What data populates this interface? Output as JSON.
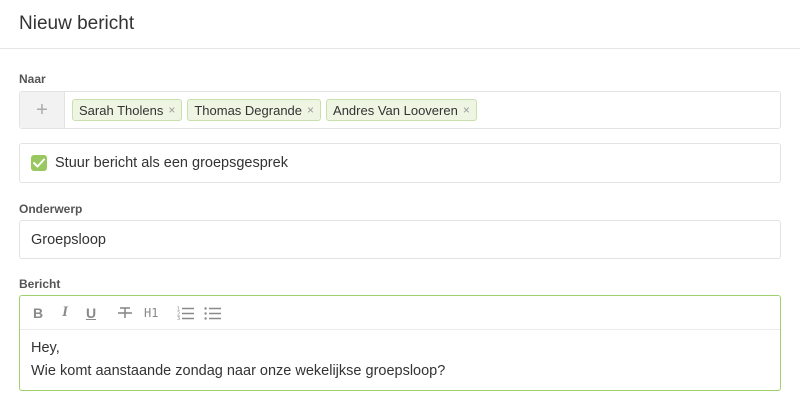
{
  "header": {
    "title": "Nieuw bericht"
  },
  "recipients": {
    "label": "Naar",
    "add_symbol": "+",
    "items": [
      {
        "name": "Sarah Tholens",
        "remove": "×"
      },
      {
        "name": "Thomas Degrande",
        "remove": "×"
      },
      {
        "name": "Andres Van Looveren",
        "remove": "×"
      }
    ]
  },
  "group_option": {
    "label": "Stuur bericht als een groepsgesprek",
    "checked": true
  },
  "subject": {
    "label": "Onderwerp",
    "value": "Groepsloop"
  },
  "message": {
    "label": "Bericht",
    "toolbar": {
      "bold": "B",
      "italic": "I",
      "underline": "U",
      "heading": "H1"
    },
    "lines": [
      "Hey,",
      "Wie komt aanstaande zondag naar onze wekelijkse groepsloop?"
    ]
  },
  "colors": {
    "accent": "#99c760",
    "chip_bg": "#eef5e3",
    "chip_border": "#c9dfae",
    "focus_border": "#9fcf6e"
  }
}
